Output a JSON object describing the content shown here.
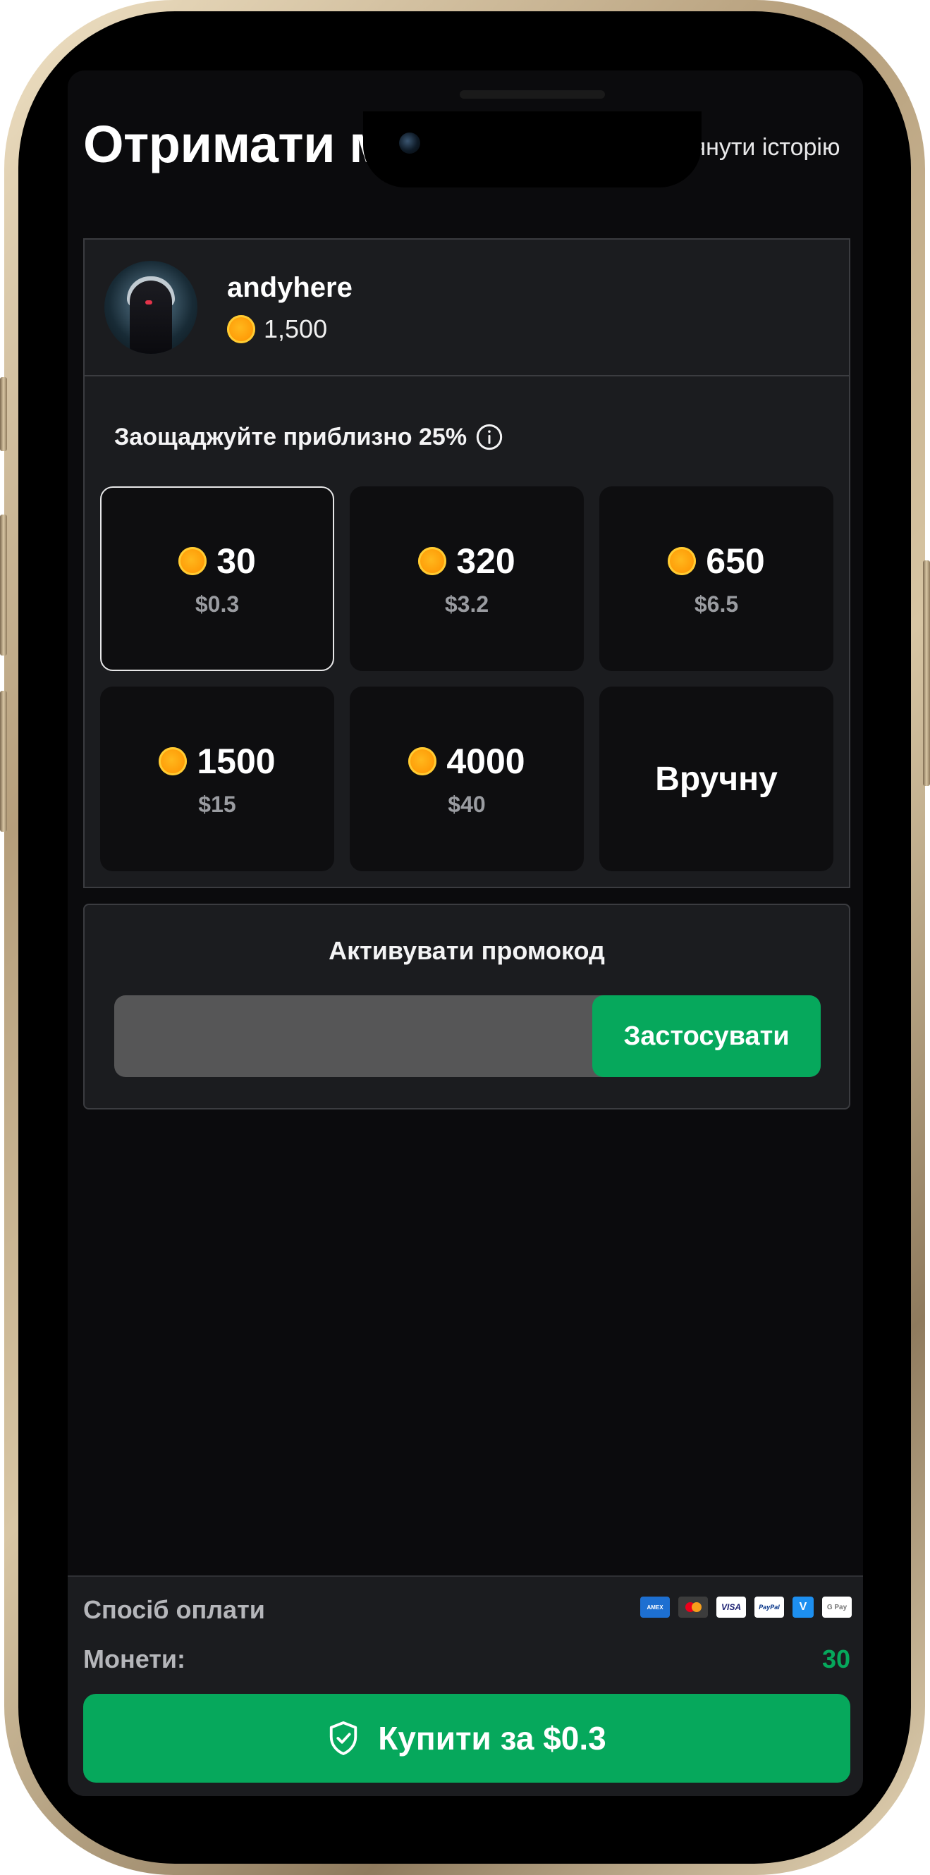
{
  "header": {
    "title": "Отримати монети",
    "history_label": "Переглянути історію"
  },
  "account": {
    "username": "andyhere",
    "balance": "1,500"
  },
  "packages": {
    "save_note": "Заощаджуйте приблизно 25%",
    "items": [
      {
        "amount": "30",
        "price": "$0.3",
        "selected": true
      },
      {
        "amount": "320",
        "price": "$3.2",
        "selected": false
      },
      {
        "amount": "650",
        "price": "$6.5",
        "selected": false
      },
      {
        "amount": "1500",
        "price": "$15",
        "selected": false
      },
      {
        "amount": "4000",
        "price": "$40",
        "selected": false
      }
    ],
    "custom_label": "Вручну"
  },
  "promo": {
    "title": "Активувати промокод",
    "input_value": "",
    "apply_label": "Застосувати"
  },
  "payment": {
    "method_label": "Спосіб оплати",
    "icons": [
      "amex-icon",
      "mastercard-icon",
      "visa-icon",
      "paypal-icon",
      "venmo-icon",
      "google-pay-icon"
    ],
    "coins_label": "Монети:",
    "coins_value": "30",
    "buy_label": "Купити за $0.3"
  },
  "colors": {
    "accent_green": "#06a85c",
    "coin": "#ff9f0a",
    "background": "#0b0b0d",
    "panel": "#1b1c1f"
  }
}
